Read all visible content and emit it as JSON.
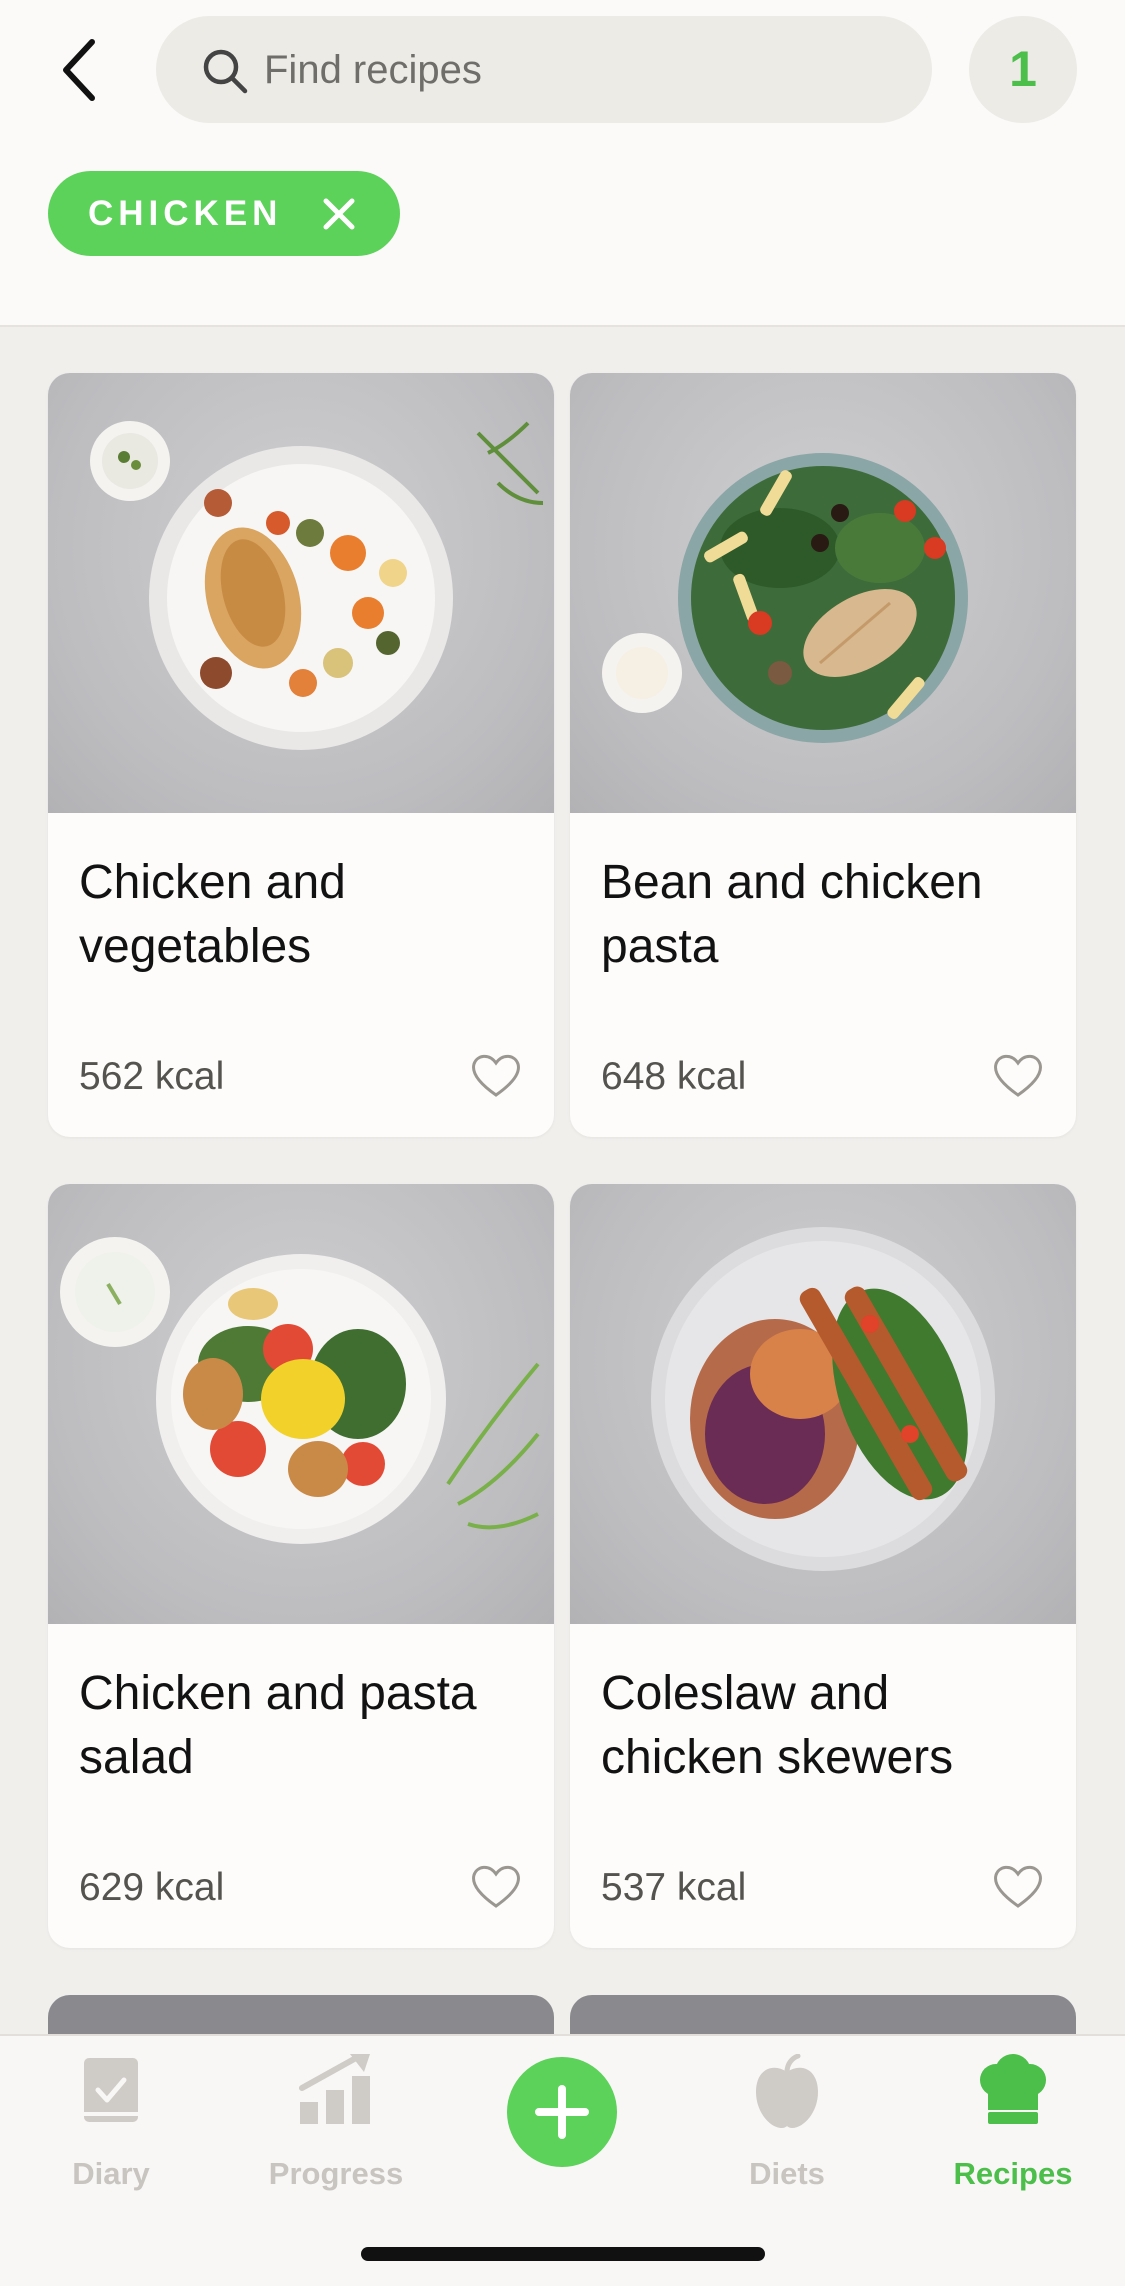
{
  "search": {
    "placeholder": "Find recipes"
  },
  "filter_count": "1",
  "active_filter": {
    "label": "CHICKEN"
  },
  "recipes": [
    {
      "title": "Chicken and vegetables",
      "kcal": "562 kcal"
    },
    {
      "title": "Bean and chicken pasta",
      "kcal": "648 kcal"
    },
    {
      "title": "Chicken and pasta salad",
      "kcal": "629 kcal"
    },
    {
      "title": "Coleslaw and chicken skewers",
      "kcal": "537 kcal"
    }
  ],
  "tabs": [
    {
      "label": "Diary",
      "icon": "book-icon"
    },
    {
      "label": "Progress",
      "icon": "bar-chart-icon"
    },
    {
      "label": "",
      "icon": "plus-icon"
    },
    {
      "label": "Diets",
      "icon": "apple-icon"
    },
    {
      "label": "Recipes",
      "icon": "chef-hat-icon"
    }
  ],
  "colors": {
    "accent": "#5cd25a",
    "accent_text": "#4cbe4a",
    "inactive_tab": "#c8c4bf"
  }
}
